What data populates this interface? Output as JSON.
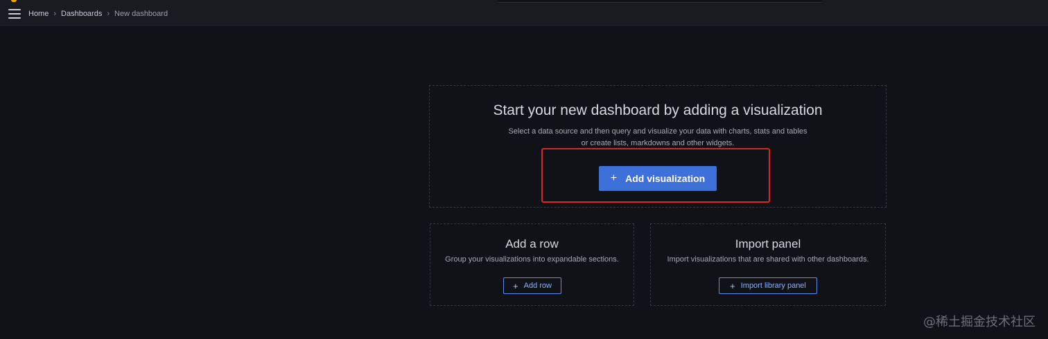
{
  "breadcrumb": {
    "home": "Home",
    "dashboards": "Dashboards",
    "current": "New dashboard",
    "separator": "›"
  },
  "empty_state": {
    "title": "Start your new dashboard by adding a visualization",
    "desc_line1": "Select a data source and then query and visualize your data with charts, stats and tables",
    "desc_line2": "or create lists, markdowns and other widgets.",
    "button_icon": "+",
    "button_label": "Add visualization"
  },
  "add_row": {
    "title": "Add a row",
    "desc": "Group your visualizations into expandable sections.",
    "button_icon": "+",
    "button_label": "Add row"
  },
  "import_panel": {
    "title": "Import panel",
    "desc": "Import visualizations that are shared with other dashboards.",
    "button_icon": "+",
    "button_label": "Import library panel"
  },
  "watermark": "@稀土掘金技术社区",
  "colors": {
    "background": "#111217",
    "primary_button": "#3d71d9",
    "highlight_border": "#e2221e",
    "outline_button": "#5c8ee6"
  },
  "icons": {
    "menu": "hamburger-menu-icon",
    "plus": "plus-icon",
    "separator": "chevron-right-icon"
  }
}
